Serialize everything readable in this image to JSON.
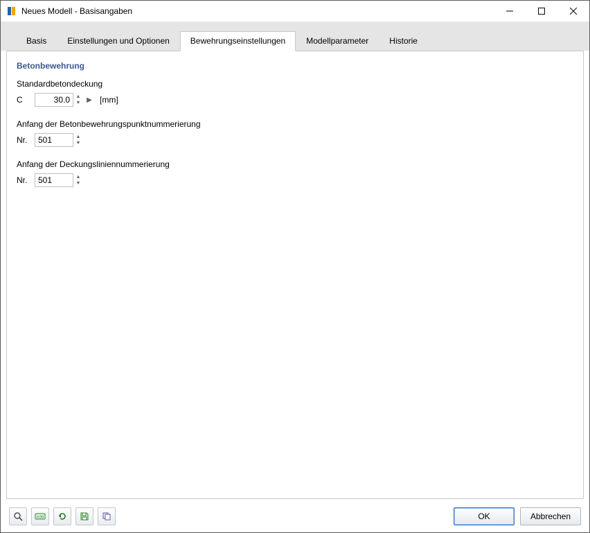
{
  "window": {
    "title": "Neues Modell - Basisangaben"
  },
  "tabs": [
    {
      "label": "Basis",
      "active": false
    },
    {
      "label": "Einstellungen und Optionen",
      "active": false
    },
    {
      "label": "Bewehrungseinstellungen",
      "active": true
    },
    {
      "label": "Modellparameter",
      "active": false
    },
    {
      "label": "Historie",
      "active": false
    }
  ],
  "section": {
    "title": "Betonbewehrung",
    "cover": {
      "label": "Standardbetondeckung",
      "symbol": "C",
      "value": "30.0",
      "unit": "[mm]"
    },
    "point_start": {
      "label": "Anfang der Betonbewehrungspunktnummerierung",
      "symbol": "Nr.",
      "value": "501"
    },
    "line_start": {
      "label": "Anfang der Deckungsliniennummerierung",
      "symbol": "Nr.",
      "value": "501"
    }
  },
  "buttons": {
    "ok": "OK",
    "cancel": "Abbrechen"
  }
}
